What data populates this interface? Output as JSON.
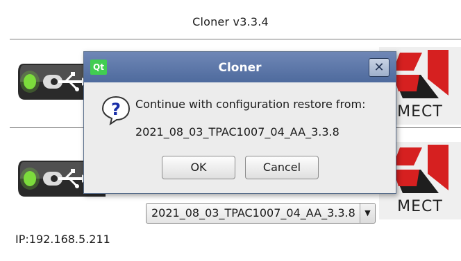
{
  "window": {
    "title": "Cloner v3.3.4"
  },
  "logo": {
    "text": "MECT"
  },
  "restore": {
    "combo_value": "2021_08_03_TPAC1007_04_AA_3.3.8",
    "dropdown_icon": "chevron-down-icon"
  },
  "status": {
    "ip": "IP:192.168.5.211"
  },
  "dialog": {
    "app_icon": "Qt",
    "title": "Cloner",
    "close_glyph": "✕",
    "message": "Continue with configuration restore from:",
    "detail": "2021_08_03_TPAC1007_04_AA_3.3.8",
    "ok_label": "OK",
    "cancel_label": "Cancel"
  },
  "colors": {
    "dialog_titlebar": "#5b76a9",
    "logo_red": "#d62020",
    "usb_led": "#7ddc3c"
  }
}
